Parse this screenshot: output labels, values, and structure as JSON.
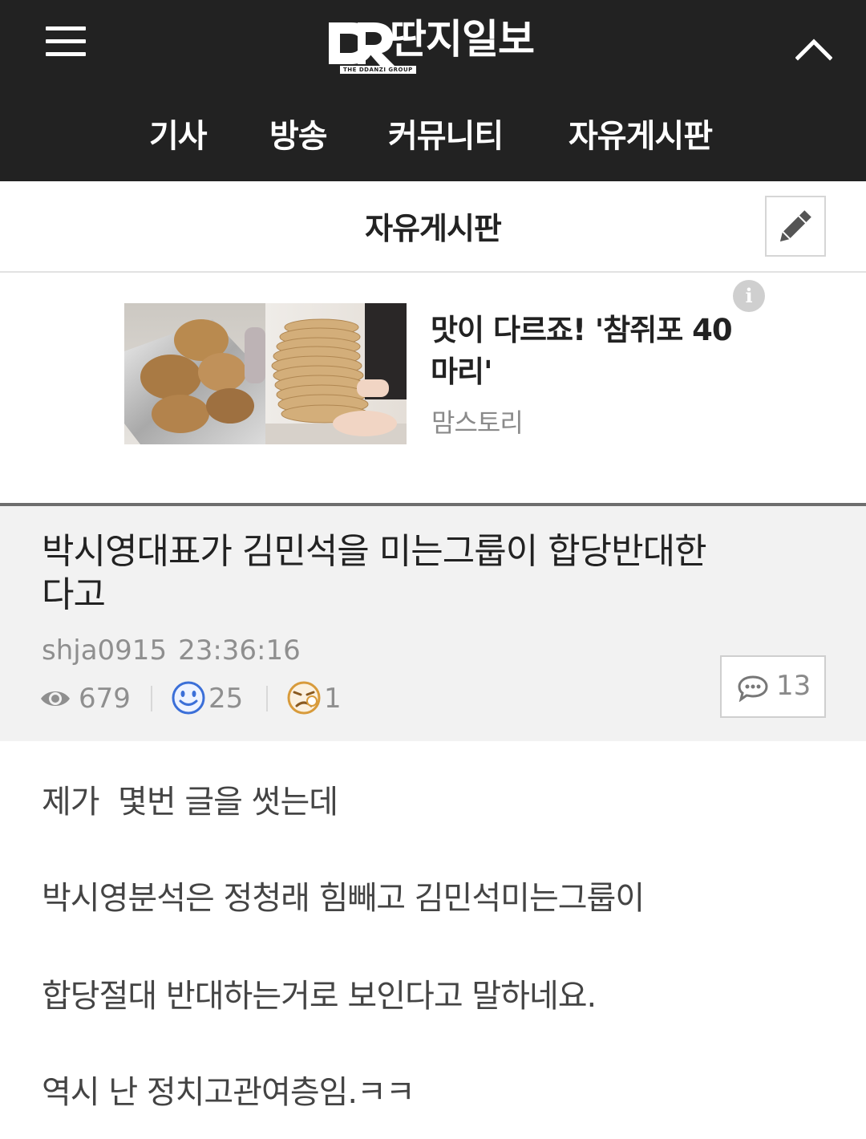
{
  "header": {
    "logo_text": "딴지일보",
    "logo_sub": "THE DDANZI GROUP",
    "nav": [
      {
        "label": "기사"
      },
      {
        "label": "방송"
      },
      {
        "label": "커뮤니티"
      },
      {
        "label": "자유게시판"
      }
    ]
  },
  "board": {
    "title": "자유게시판"
  },
  "ad": {
    "title": "맛이 다르죠! '참쥐포 40마리'",
    "source": "맘스토리"
  },
  "post": {
    "title": "박시영대표가 김민석을 미는그룹이 합당반대한다고",
    "author": "shja0915",
    "time": "23:36:16",
    "views": "679",
    "likes": "25",
    "dislikes": "1",
    "comments": "13",
    "body": [
      "제가  몇번 글을 썻는데",
      "박시영분석은 정청래 힘빼고 김민석미는그룹이",
      "합당절대 반대하는거로 보인다고 말하네요.",
      "역시 난 정치고관여층임.ㅋㅋ"
    ]
  },
  "colors": {
    "header_bg": "#222222",
    "post_head_bg": "#f2f2f2",
    "like_blue": "#3b6fd8",
    "dislike_orange": "#d89b3b"
  }
}
